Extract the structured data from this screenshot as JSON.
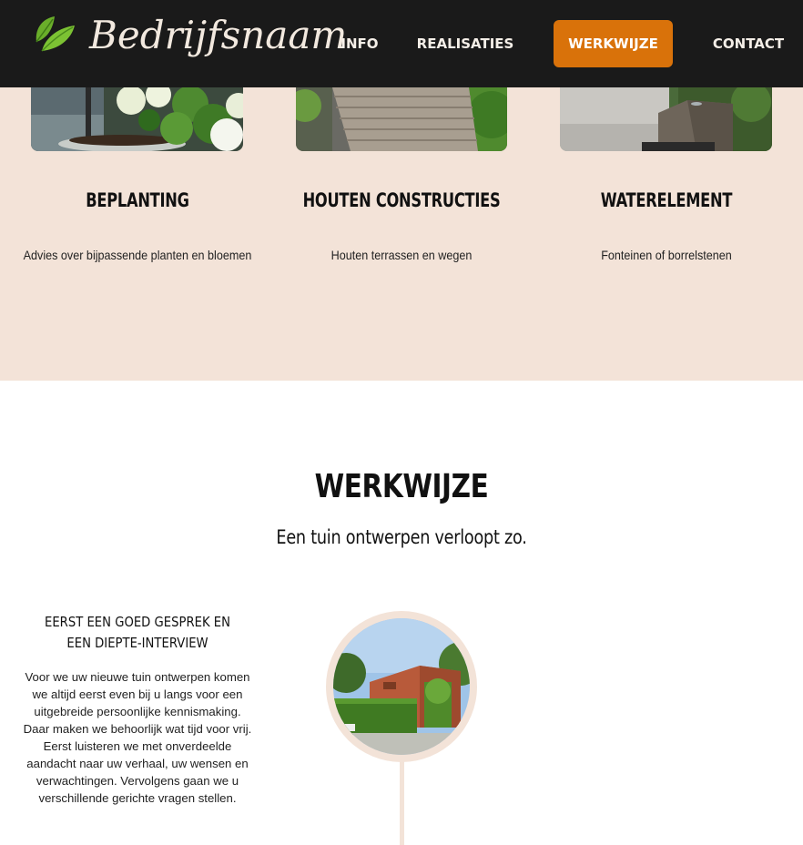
{
  "header": {
    "brand": "Bedrijfsnaam",
    "nav": [
      {
        "label": "INFO",
        "active": false
      },
      {
        "label": "REALISATIES",
        "active": false
      },
      {
        "label": "WERKWIJZE",
        "active": true
      },
      {
        "label": "CONTACT",
        "active": false
      }
    ],
    "accent_color": "#d9720a",
    "background_color": "#1a1a1a"
  },
  "services": {
    "background_color": "#f3e3d8",
    "items": [
      {
        "title": "BEPLANTING",
        "description": "Advies over bijpassende planten en bloemen",
        "image": "planter-with-hydrangeas"
      },
      {
        "title": "HOUTEN CONSTRUCTIES",
        "description": "Houten terrassen en wegen",
        "image": "wooden-garden-path"
      },
      {
        "title": "WATERELEMENT",
        "description": "Fonteinen of borrelstenen",
        "image": "stone-water-fountain"
      }
    ]
  },
  "werkwijze": {
    "title": "WERKWIJZE",
    "subtitle": "Een tuin ontwerpen verloopt zo.",
    "steps": [
      {
        "title": "EERST EEN GOED GESPREK EN EEN DIEPTE-INTERVIEW",
        "text": "Voor we uw nieuwe tuin ontwerpen komen we altijd eerst even bij u langs voor een uitgebreide persoonlijke kennismaking. Daar maken we behoorlijk wat tijd voor vrij. Eerst luisteren we met onverdeelde aandacht naar uw verhaal, uw wensen en verwachtingen. Vervolgens gaan we u verschillende gerichte vragen stellen.",
        "image": "brick-house-with-hedge"
      }
    ]
  }
}
